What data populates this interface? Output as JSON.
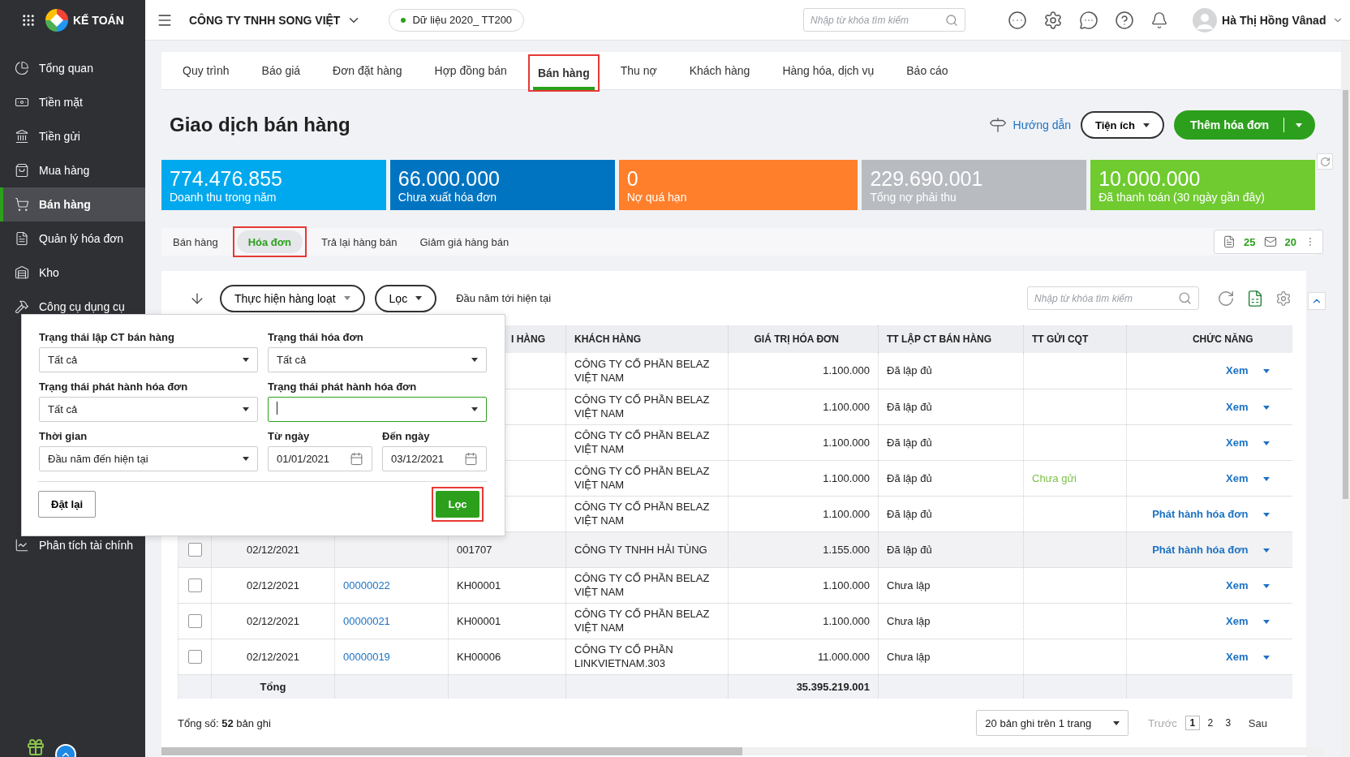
{
  "app": {
    "name": "KẾ TOÁN"
  },
  "header": {
    "company": "CÔNG TY TNHH SONG VIỆT",
    "dataset": "Dữ liệu 2020_ TT200",
    "search": {
      "placeholder": "Nhập từ khóa tìm kiếm"
    },
    "user": "Hà Thị Hồng Vânad"
  },
  "sidebar": {
    "items": [
      {
        "label": "Tổng quan",
        "selected": false
      },
      {
        "label": "Tiền mặt",
        "selected": false
      },
      {
        "label": "Tiền gửi",
        "selected": false
      },
      {
        "label": "Mua hàng",
        "selected": false
      },
      {
        "label": "Bán hàng",
        "selected": true
      },
      {
        "label": "Quản lý hóa đơn",
        "selected": false
      },
      {
        "label": "Kho",
        "selected": false
      },
      {
        "label": "Công cụ dụng cụ",
        "selected": false
      }
    ],
    "bottom_items": [
      {
        "label": "Phân tích tài chính",
        "selected": false
      }
    ]
  },
  "module_tabs": [
    {
      "label": "Quy trình",
      "selected": false,
      "callout": false
    },
    {
      "label": "Báo giá",
      "selected": false,
      "callout": false
    },
    {
      "label": "Đơn đặt hàng",
      "selected": false,
      "callout": false
    },
    {
      "label": "Hợp đồng bán",
      "selected": false,
      "callout": false
    },
    {
      "label": "Bán hàng",
      "selected": true,
      "callout": true
    },
    {
      "label": "Thu nợ",
      "selected": false,
      "callout": false
    },
    {
      "label": "Khách hàng",
      "selected": false,
      "callout": false
    },
    {
      "label": "Hàng hóa, dịch vụ",
      "selected": false,
      "callout": false
    },
    {
      "label": "Báo cáo",
      "selected": false,
      "callout": false
    }
  ],
  "page_title": "Giao dịch bán hàng",
  "actions": {
    "guide": "Hướng dẫn",
    "utilities": "Tiện ích",
    "add_invoice": "Thêm hóa đơn"
  },
  "kpis": [
    {
      "value": "774.476.855",
      "label": "Doanh thu trong năm",
      "color": "#00a8ee"
    },
    {
      "value": "66.000.000",
      "label": "Chưa xuất hóa đơn",
      "color": "#0074c1"
    },
    {
      "value": "0",
      "label": "Nợ quá hạn",
      "color": "#ff7f2a"
    },
    {
      "value": "229.690.001",
      "label": "Tổng nợ phải thu",
      "color": "#b8bbc0"
    },
    {
      "value": "10.000.000",
      "label": "Đã thanh toán (30 ngày gần đây)",
      "color": "#6fcb30"
    }
  ],
  "sub_tabs": [
    {
      "label": "Bán hàng",
      "selected": false,
      "callout": false
    },
    {
      "label": "Hóa đơn",
      "selected": true,
      "callout": true
    },
    {
      "label": "Trả lại hàng bán",
      "selected": false,
      "callout": false
    },
    {
      "label": "Giảm giá hàng bán",
      "selected": false,
      "callout": false
    }
  ],
  "counters": [
    {
      "value": "25",
      "kind": "document"
    },
    {
      "value": "20",
      "kind": "mail"
    }
  ],
  "toolbar": {
    "bulk": "Thực hiện hàng loạt",
    "filter": "Lọc",
    "period": "Đầu năm tới hiện tại",
    "search": {
      "placeholder": "Nhập từ khóa tìm kiếm"
    }
  },
  "table": {
    "columns": [
      {
        "label": "I HÀNG"
      },
      {
        "label": "KHÁCH HÀNG"
      },
      {
        "label": "GIÁ TRỊ HÓA ĐƠN"
      },
      {
        "label": "TT LẬP CT BÁN HÀNG"
      },
      {
        "label": "TT GỬI CQT"
      },
      {
        "label": "CHỨC NĂNG"
      }
    ],
    "rows": [
      {
        "customer": "CÔNG TY CỔ PHẦN BELAZ VIỆT NAM",
        "amount": "1.100.000",
        "status": "Đã lập đủ",
        "action": "Xem",
        "highlighted": false
      },
      {
        "customer": "CÔNG TY CỔ PHẦN BELAZ VIỆT NAM",
        "amount": "1.100.000",
        "status": "Đã lập đủ",
        "action": "Xem",
        "highlighted": false
      },
      {
        "customer": "CÔNG TY CỔ PHẦN BELAZ VIỆT NAM",
        "amount": "1.100.000",
        "status": "Đã lập đủ",
        "action": "Xem",
        "highlighted": false
      },
      {
        "customer": "CÔNG TY CỔ PHẦN BELAZ VIỆT NAM",
        "amount": "1.100.000",
        "status": "Đã lập đủ",
        "cqt": "Chưa gửi",
        "action": "Xem",
        "highlighted": false
      },
      {
        "customer": "CÔNG TY CỔ PHẦN BELAZ VIỆT NAM",
        "amount": "1.100.000",
        "status": "Đã lập đủ",
        "action": "Phát hành hóa đơn",
        "highlighted": false
      },
      {
        "checked": false,
        "date": "02/12/2021",
        "code": "001707",
        "customer": "CÔNG TY TNHH HẢI TÙNG",
        "amount": "1.155.000",
        "status": "Đã lập đủ",
        "action": "Phát hành hóa đơn",
        "highlighted": true
      },
      {
        "checked": false,
        "date": "02/12/2021",
        "number": "00000022",
        "code": "KH00001",
        "customer": "CÔNG TY CỔ PHẦN BELAZ VIỆT NAM",
        "amount": "1.100.000",
        "status": "Chưa lập",
        "action": "Xem",
        "highlighted": false
      },
      {
        "checked": false,
        "date": "02/12/2021",
        "number": "00000021",
        "code": "KH00001",
        "customer": "CÔNG TY CỔ PHẦN BELAZ VIỆT NAM",
        "amount": "1.100.000",
        "status": "Chưa lập",
        "action": "Xem",
        "highlighted": false
      },
      {
        "checked": false,
        "date": "02/12/2021",
        "number": "00000019",
        "code": "KH00006",
        "customer": "CÔNG TY CỔ PHẦN LINKVIETNAM.303",
        "amount": "11.000.000",
        "status": "Chưa lập",
        "action": "Xem",
        "highlighted": false
      }
    ],
    "total": {
      "label": "Tổng",
      "value": "35.395.219.001"
    }
  },
  "footer": {
    "summary": "Tổng số: **52** bản ghi",
    "page_size": "20 bản ghi trên 1 trang",
    "prev": "Trước",
    "pages": [
      {
        "label": "1",
        "selected": true
      },
      {
        "label": "2",
        "selected": false
      },
      {
        "label": "3",
        "selected": false
      }
    ],
    "next": "Sau"
  },
  "filter_panel": {
    "fields": [
      {
        "label": "Trạng thái lập CT bán hàng",
        "value": "Tất cả",
        "kind": "select",
        "focused": false
      },
      {
        "label": "Trạng thái hóa đơn",
        "value": "Tất cả",
        "kind": "select",
        "focused": false
      },
      {
        "label": "Trạng thái phát hành hóa đơn",
        "value": "Tất cả",
        "kind": "select",
        "focused": false
      },
      {
        "label": "Trạng thái phát hành hóa đơn",
        "kind": "select",
        "focused": true
      },
      {
        "label": "Thời gian",
        "value": "Đầu năm đến hiện tại",
        "kind": "select",
        "focused": false
      },
      {
        "label": "Từ ngày",
        "value": "01/01/2021",
        "kind": "date",
        "focused": false
      },
      {
        "label": "Đến ngày",
        "value": "03/12/2021",
        "kind": "date",
        "focused": false
      }
    ],
    "reset": "Đặt lại",
    "apply": {
      "label": "Lọc",
      "callout": true
    }
  }
}
